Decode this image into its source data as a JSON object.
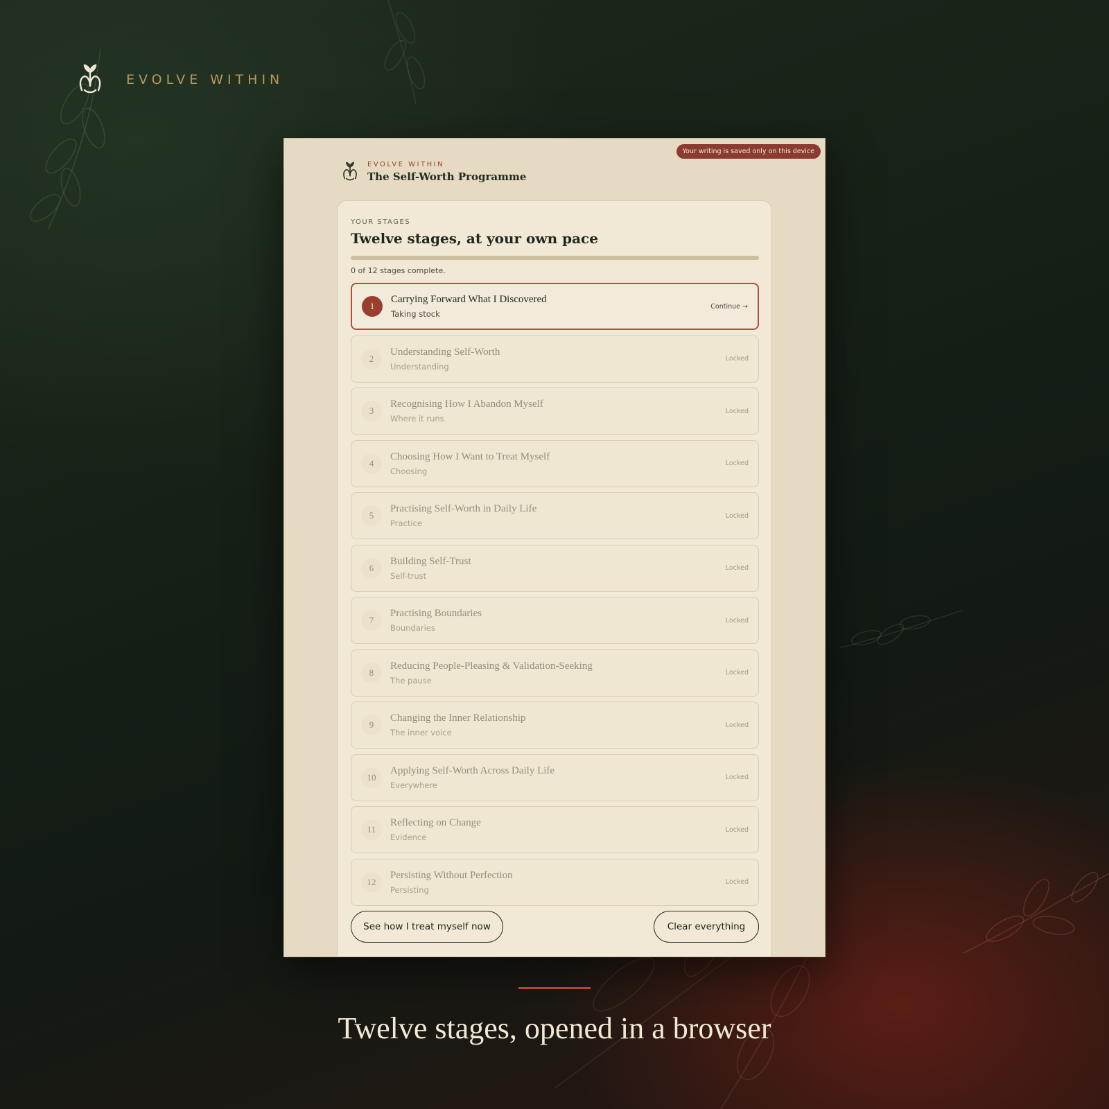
{
  "brand": {
    "name": "EVOLVE WITHIN",
    "logo_icon": "sprout-monogram-icon"
  },
  "window": {
    "device_badge": "Your writing is saved only on this device",
    "header": {
      "kicker": "EVOLVE WITHIN",
      "title": "The Self-Worth Programme"
    },
    "stages_card": {
      "label": "YOUR STAGES",
      "title": "Twelve stages, at your own pace",
      "progress": {
        "completed": 0,
        "total": 12,
        "fraction": 0,
        "text": "0 of 12 stages complete."
      },
      "stages": [
        {
          "num": "1",
          "title": "Carrying Forward What I Discovered",
          "sub": "Taking stock",
          "status": "Continue →",
          "active": true
        },
        {
          "num": "2",
          "title": "Understanding Self-Worth",
          "sub": "Understanding",
          "status": "Locked"
        },
        {
          "num": "3",
          "title": "Recognising How I Abandon Myself",
          "sub": "Where it runs",
          "status": "Locked"
        },
        {
          "num": "4",
          "title": "Choosing How I Want to Treat Myself",
          "sub": "Choosing",
          "status": "Locked"
        },
        {
          "num": "5",
          "title": "Practising Self-Worth in Daily Life",
          "sub": "Practice",
          "status": "Locked"
        },
        {
          "num": "6",
          "title": "Building Self-Trust",
          "sub": "Self-trust",
          "status": "Locked"
        },
        {
          "num": "7",
          "title": "Practising Boundaries",
          "sub": "Boundaries",
          "status": "Locked"
        },
        {
          "num": "8",
          "title": "Reducing People-Pleasing & Validation-Seeking",
          "sub": "The pause",
          "status": "Locked"
        },
        {
          "num": "9",
          "title": "Changing the Inner Relationship",
          "sub": "The inner voice",
          "status": "Locked"
        },
        {
          "num": "10",
          "title": "Applying Self-Worth Across Daily Life",
          "sub": "Everywhere",
          "status": "Locked"
        },
        {
          "num": "11",
          "title": "Reflecting on Change",
          "sub": "Evidence",
          "status": "Locked"
        },
        {
          "num": "12",
          "title": "Persisting Without Perfection",
          "sub": "Persisting",
          "status": "Locked"
        }
      ],
      "buttons": {
        "see_how": "See how I treat myself now",
        "clear": "Clear everything"
      }
    }
  },
  "caption": "Twelve stages, opened in a browser",
  "colors": {
    "accent": "#9a4334",
    "brand_gold": "#b9975e",
    "card": "#f1e9d6",
    "ink": "#20281e"
  }
}
